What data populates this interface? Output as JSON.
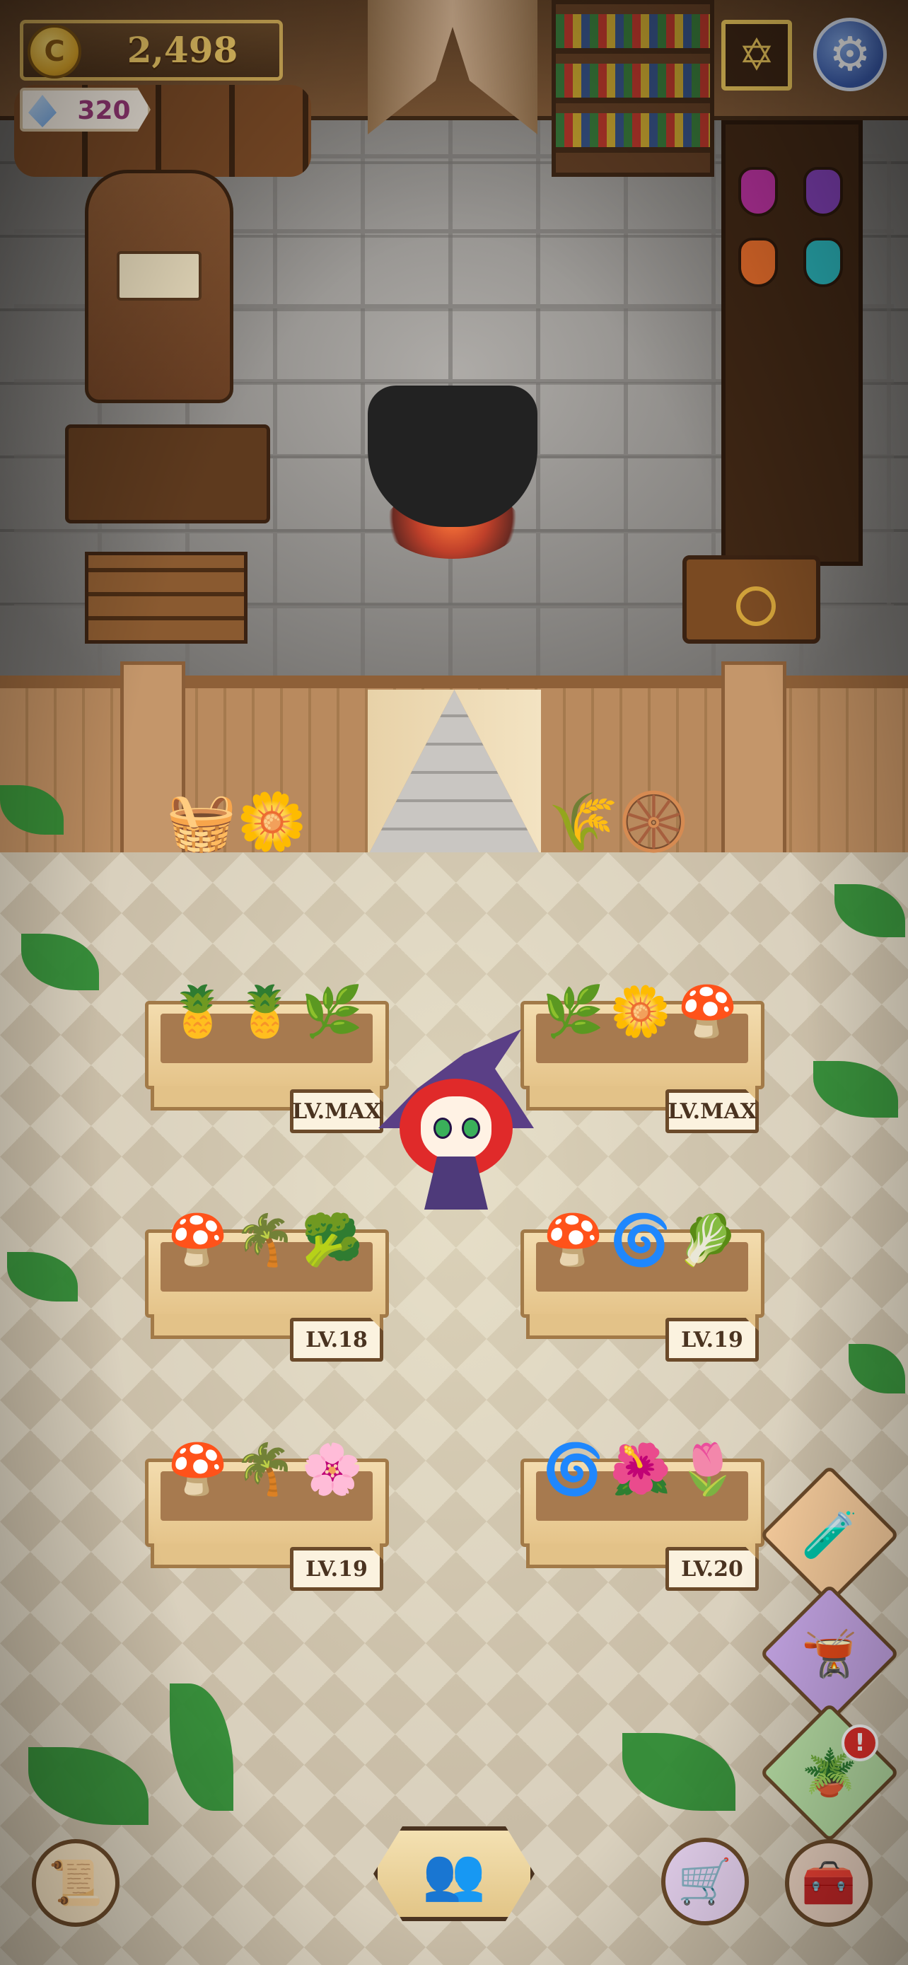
{
  "hud": {
    "coins": "2,498",
    "coin_symbol": "C",
    "gems": "320",
    "spellbook_icon": "hexagram-icon",
    "settings_icon": "gear-icon"
  },
  "garden": {
    "planters": [
      {
        "level": "LV.MAX",
        "plants": [
          "🍍",
          "🍍",
          "🌿"
        ]
      },
      {
        "level": "LV.MAX",
        "plants": [
          "🌿",
          "🌼",
          "🍄"
        ]
      },
      {
        "level": "LV.18",
        "plants": [
          "🍄",
          "🌴",
          "🥦"
        ]
      },
      {
        "level": "LV.19",
        "plants": [
          "🍄",
          "🌀",
          "🥬"
        ]
      },
      {
        "level": "LV.19",
        "plants": [
          "🍄",
          "🌴",
          "🌸"
        ]
      },
      {
        "level": "LV.20",
        "plants": [
          "🌀",
          "🌺",
          "🌷"
        ]
      }
    ]
  },
  "side_buttons": [
    {
      "name": "potion-shop-button",
      "icon": "🧪",
      "color": "#f3c99a"
    },
    {
      "name": "cauldron-button",
      "icon": "🫕",
      "color": "#c6a6e6"
    },
    {
      "name": "garden-plot-button",
      "icon": "🪴",
      "color": "#b9e0a6",
      "badge": "!"
    }
  ],
  "bottom_bar": {
    "recipes_icon": "📜",
    "customers_icon": "👥",
    "cart_icon": "🛒",
    "storage_icon": "🧰"
  }
}
